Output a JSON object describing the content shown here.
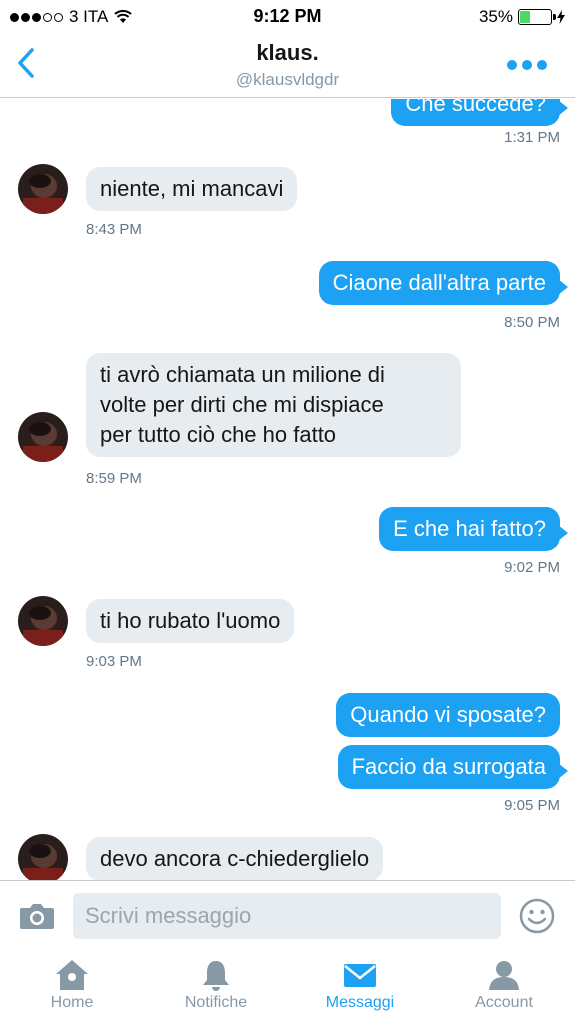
{
  "status": {
    "carrier": "3 ITA",
    "time": "9:12 PM",
    "battery_percent": "35%",
    "battery_level": 0.35,
    "signal_bars": 3
  },
  "header": {
    "name": "klaus.",
    "handle": "@klausvldgdr"
  },
  "messages": {
    "m0": {
      "text": "Che succede?",
      "time": "1:31 PM"
    },
    "m1": {
      "text": "niente, mi mancavi",
      "time": "8:43 PM"
    },
    "m2": {
      "text": "Ciaone dall'altra parte",
      "time": "8:50 PM"
    },
    "m3": {
      "line1": "ti avrò chiamata un milione di",
      "line2": "volte per dirti che mi dispiace",
      "line3": "per tutto ciò che ho fatto",
      "time": "8:59 PM"
    },
    "m4": {
      "text": "E che hai fatto?",
      "time": "9:02 PM"
    },
    "m5": {
      "text": "ti ho rubato l'uomo",
      "time": "9:03 PM"
    },
    "m6": {
      "text": "Quando vi sposate?"
    },
    "m7": {
      "text": "Faccio da surrogata",
      "time": "9:05 PM"
    },
    "m8": {
      "text": "devo ancora c-chiederglielo"
    }
  },
  "composer": {
    "placeholder": "Scrivi messaggio"
  },
  "tabs": {
    "home": "Home",
    "notifications": "Notifiche",
    "messages": "Messaggi",
    "account": "Account"
  },
  "colors": {
    "accent": "#1da1f2",
    "incoming_bubble": "#e6ecf0",
    "battery": "#4cd964"
  },
  "icons": [
    "back-chevron-icon",
    "more-dots-icon",
    "camera-icon",
    "emoji-icon",
    "home-icon",
    "bell-icon",
    "envelope-icon",
    "account-icon",
    "wifi-icon",
    "charging-bolt-icon"
  ]
}
